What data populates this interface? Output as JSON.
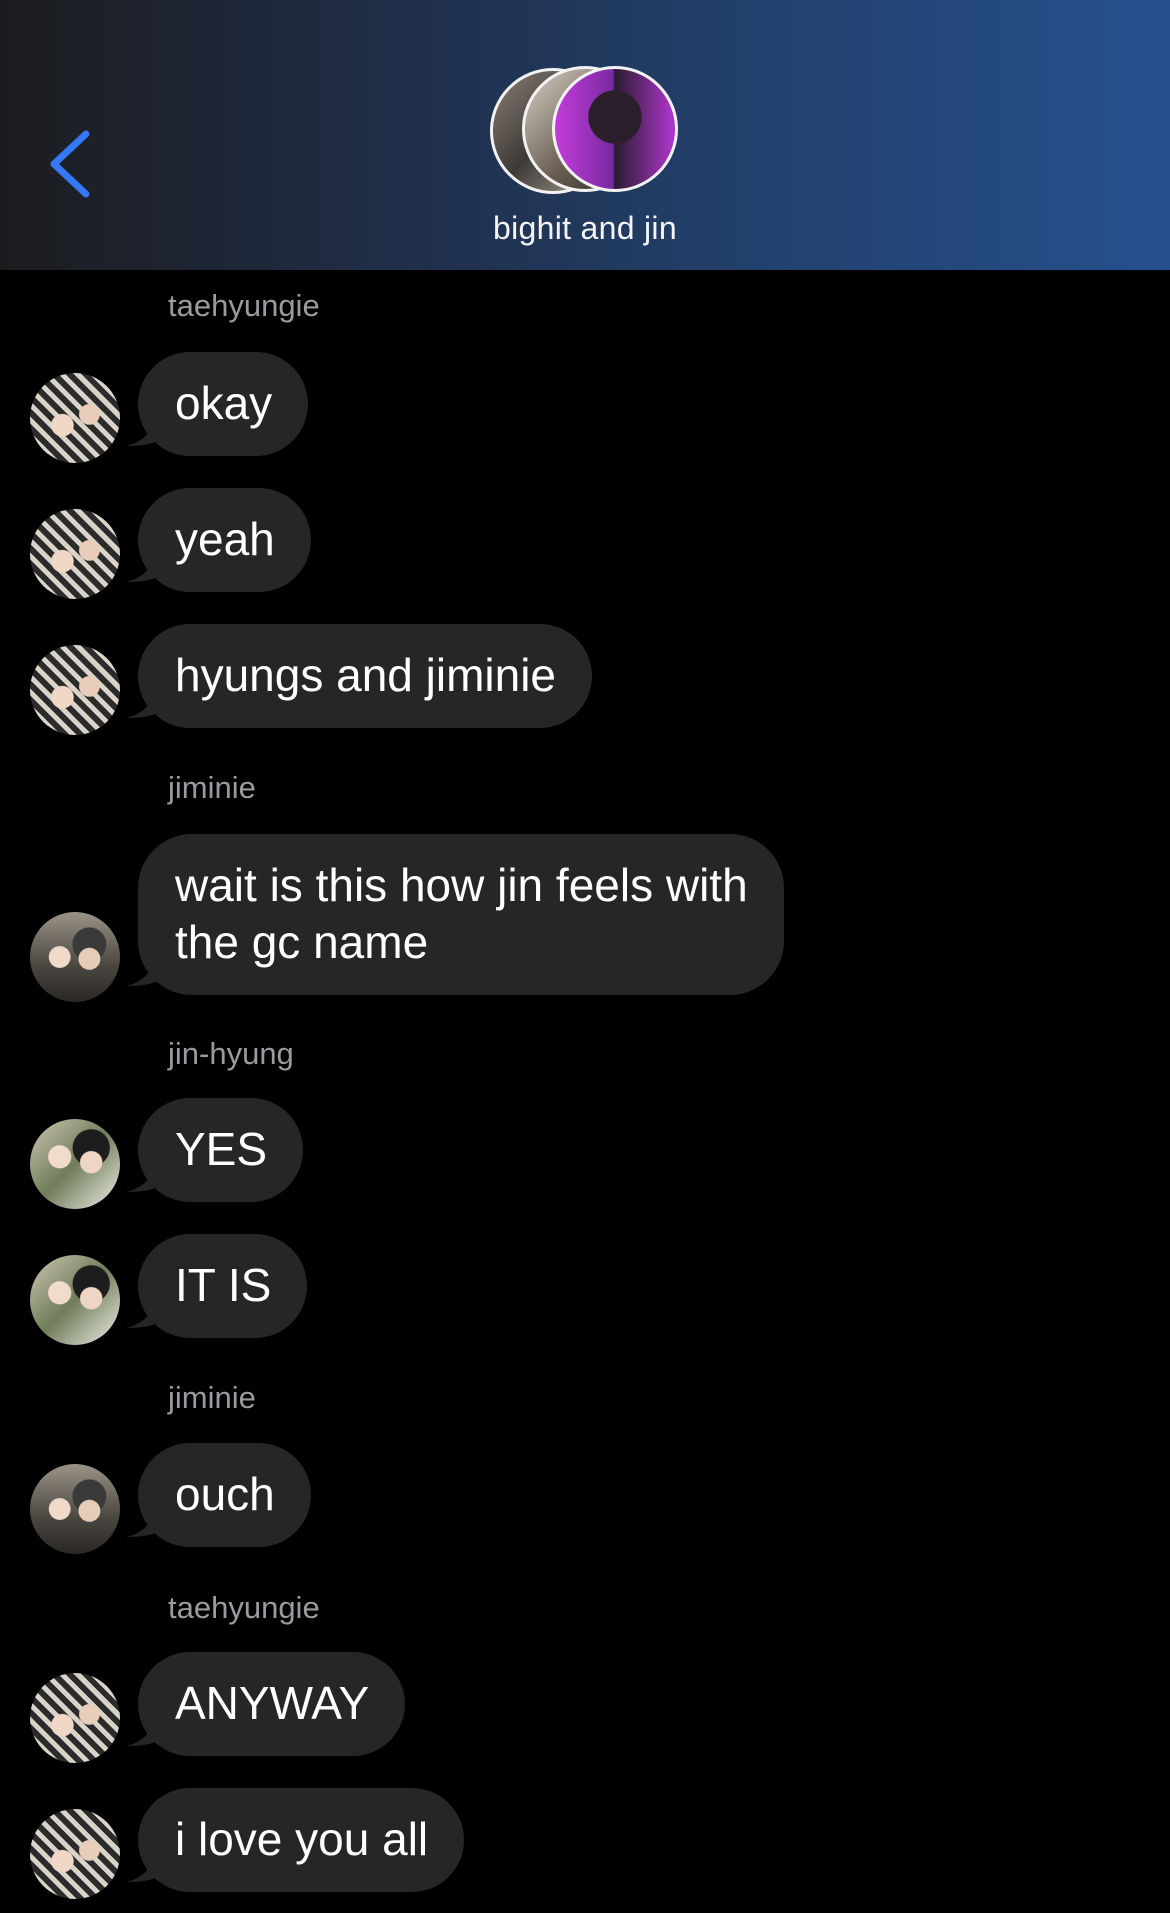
{
  "header": {
    "back_icon": "chevron-left-icon",
    "title": "bighit and jin",
    "colors": {
      "back": "#3478f6",
      "gradient_end": "#26508e"
    }
  },
  "messages": [
    {
      "sender": "taehyungie",
      "avatar": "taehyungie-avatar",
      "texts": [
        "okay",
        "yeah",
        "hyungs and jiminie"
      ]
    },
    {
      "sender": "jiminie",
      "avatar": "jiminie-avatar",
      "texts": [
        "wait is this how jin feels with\nthe gc name"
      ]
    },
    {
      "sender": "jin-hyung",
      "avatar": "jin-hyung-avatar",
      "texts": [
        "YES",
        "IT IS"
      ]
    },
    {
      "sender": "jiminie",
      "avatar": "jiminie-avatar",
      "texts": [
        "ouch"
      ]
    },
    {
      "sender": "taehyungie",
      "avatar": "taehyungie-avatar",
      "texts": [
        "ANYWAY",
        "i love you all"
      ]
    }
  ],
  "colors": {
    "background": "#000000",
    "bubble": "#262628",
    "sender": "#9a9a9f"
  }
}
